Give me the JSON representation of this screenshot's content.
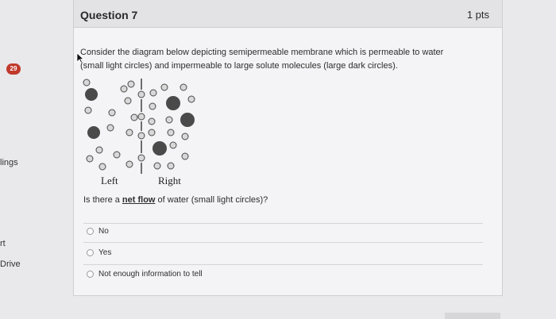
{
  "rail": {
    "badge_count": "29",
    "items": [
      "lings",
      "rt",
      "Drive"
    ]
  },
  "question": {
    "title": "Question 7",
    "points": "1 pts",
    "prompt_line1": "Consider the diagram below depicting semipermeable membrane which is permeable to water",
    "prompt_line2": "(small light circles) and impermeable to large solute molecules (large dark circles).",
    "diagram_left_label": "Left",
    "diagram_right_label": "Right",
    "ask_prefix": "Is there a ",
    "ask_emphasis": "net flow",
    "ask_suffix": " of water (small light circles)?",
    "options": [
      "No",
      "Yes",
      "Not enough information to tell"
    ]
  },
  "colors": {
    "badge": "#c0392b",
    "solute": "#4a4a4a",
    "water_fill": "#d8d8d8",
    "water_stroke": "#4a4a4a"
  }
}
